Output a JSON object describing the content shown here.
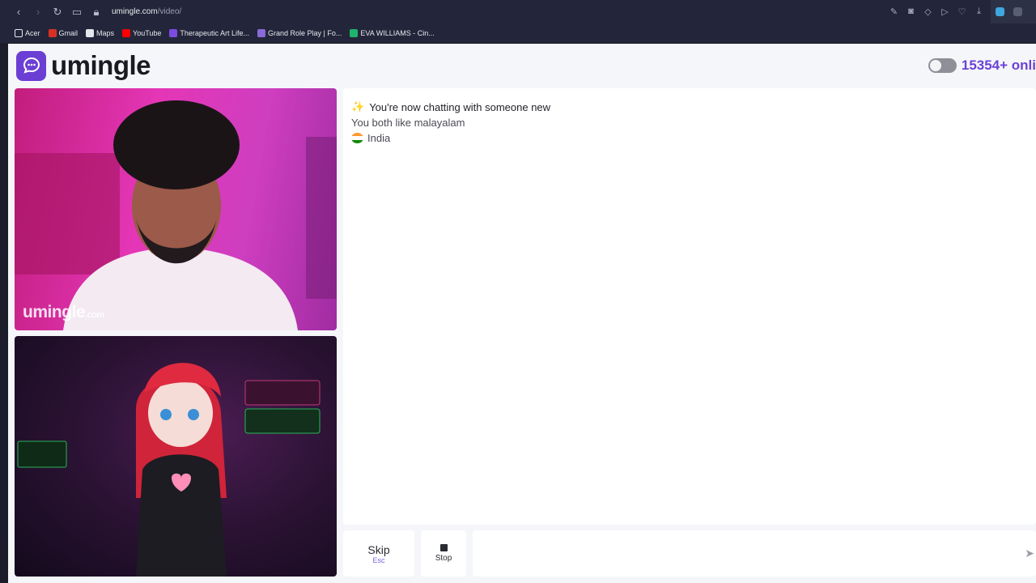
{
  "browser": {
    "url_domain": "umingle.com",
    "url_path": "/video/",
    "bookmarks": [
      {
        "label": "Acer",
        "color": "#e6e7ee"
      },
      {
        "label": "Gmail",
        "color": "#d93025"
      },
      {
        "label": "Maps",
        "color": "#e6e7ee"
      },
      {
        "label": "YouTube",
        "color": "#ff0000"
      },
      {
        "label": "Therapeutic Art Life...",
        "color": "#7b4ce0"
      },
      {
        "label": "Grand Role Play | Fo...",
        "color": "#8a6ad8"
      },
      {
        "label": "EVA WILLIAMS - Cin...",
        "color": "#1fb36b"
      }
    ]
  },
  "header": {
    "logo_text": "umingle",
    "online_count": "15354+ onli",
    "accent": "#6a41d8"
  },
  "videos": {
    "watermark_main": "umingle",
    "watermark_suffix": ".com"
  },
  "chat": {
    "title": "You're now chatting with someone new",
    "interest": "You both like malayalam",
    "country": "India"
  },
  "controls": {
    "skip_label": "Skip",
    "skip_hint": "Esc",
    "stop_label": "Stop",
    "message_placeholder": ""
  }
}
